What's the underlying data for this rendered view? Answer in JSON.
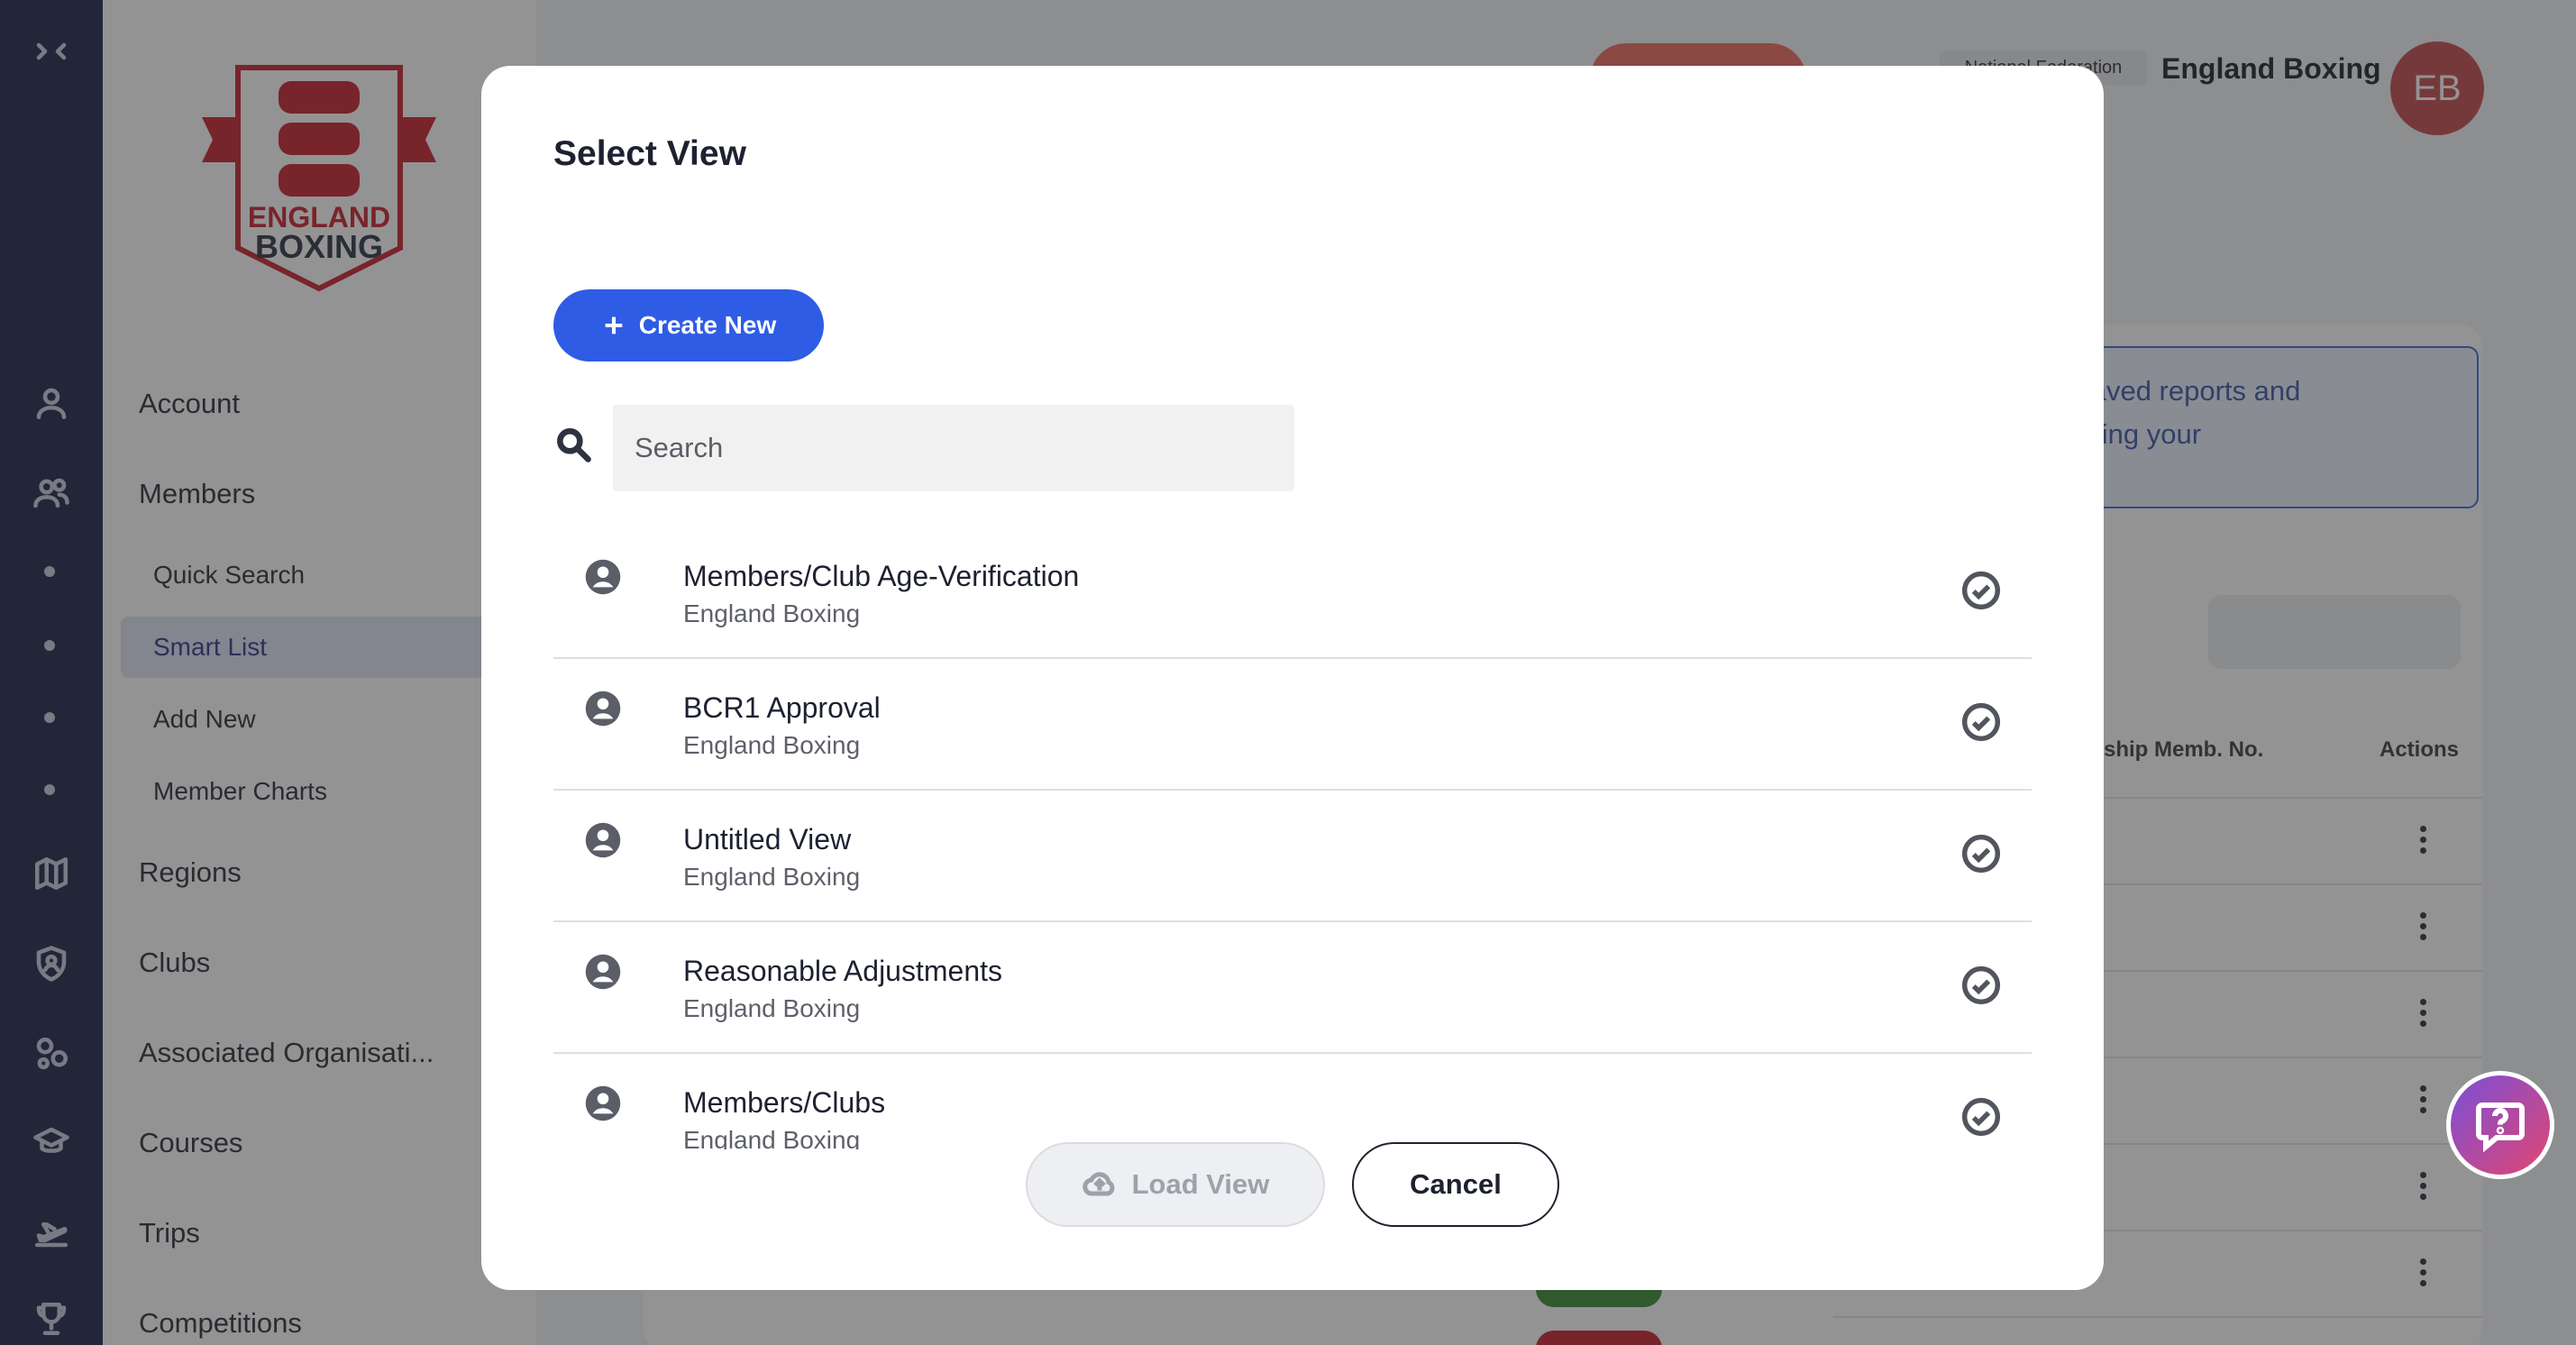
{
  "rail": {
    "icons": [
      "collapse-icon",
      "user-icon",
      "users-icon",
      "map-icon",
      "shield-user-icon",
      "groups-icon",
      "graduation-cap-icon",
      "plane-icon",
      "trophy-icon"
    ]
  },
  "sidebar": {
    "logo_text_1": "ENGLAND",
    "logo_text_2": "BOXING",
    "items": [
      {
        "label": "Account"
      },
      {
        "label": "Members"
      },
      {
        "label": "Quick Search"
      },
      {
        "label": "Smart List"
      },
      {
        "label": "Add New"
      },
      {
        "label": "Member Charts"
      },
      {
        "label": "Regions"
      },
      {
        "label": "Clubs"
      },
      {
        "label": "Associated Organisati..."
      },
      {
        "label": "Courses"
      },
      {
        "label": "Trips"
      },
      {
        "label": "Competitions"
      }
    ]
  },
  "header": {
    "badge": "National Federation",
    "org_name": "England Boxing",
    "avatar_initials": "EB"
  },
  "background": {
    "info_text": "evious saved reports and transitioning your",
    "col_membership": "ship Memb. No.",
    "col_actions": "Actions"
  },
  "dialog": {
    "title": "Select View",
    "create_label": "Create New",
    "search_placeholder": "Search",
    "views": [
      {
        "name": "Members/Club Age-Verification",
        "owner": "England Boxing"
      },
      {
        "name": "BCR1 Approval",
        "owner": "England Boxing"
      },
      {
        "name": "Untitled View",
        "owner": "England Boxing"
      },
      {
        "name": "Reasonable Adjustments",
        "owner": "England Boxing"
      },
      {
        "name": "Members/Clubs",
        "owner": "England Boxing"
      }
    ],
    "load_label": "Load View",
    "cancel_label": "Cancel"
  },
  "colors": {
    "rail": "#1c2448",
    "primary": "#2f5ce5",
    "brand_red": "#c44a4f"
  }
}
